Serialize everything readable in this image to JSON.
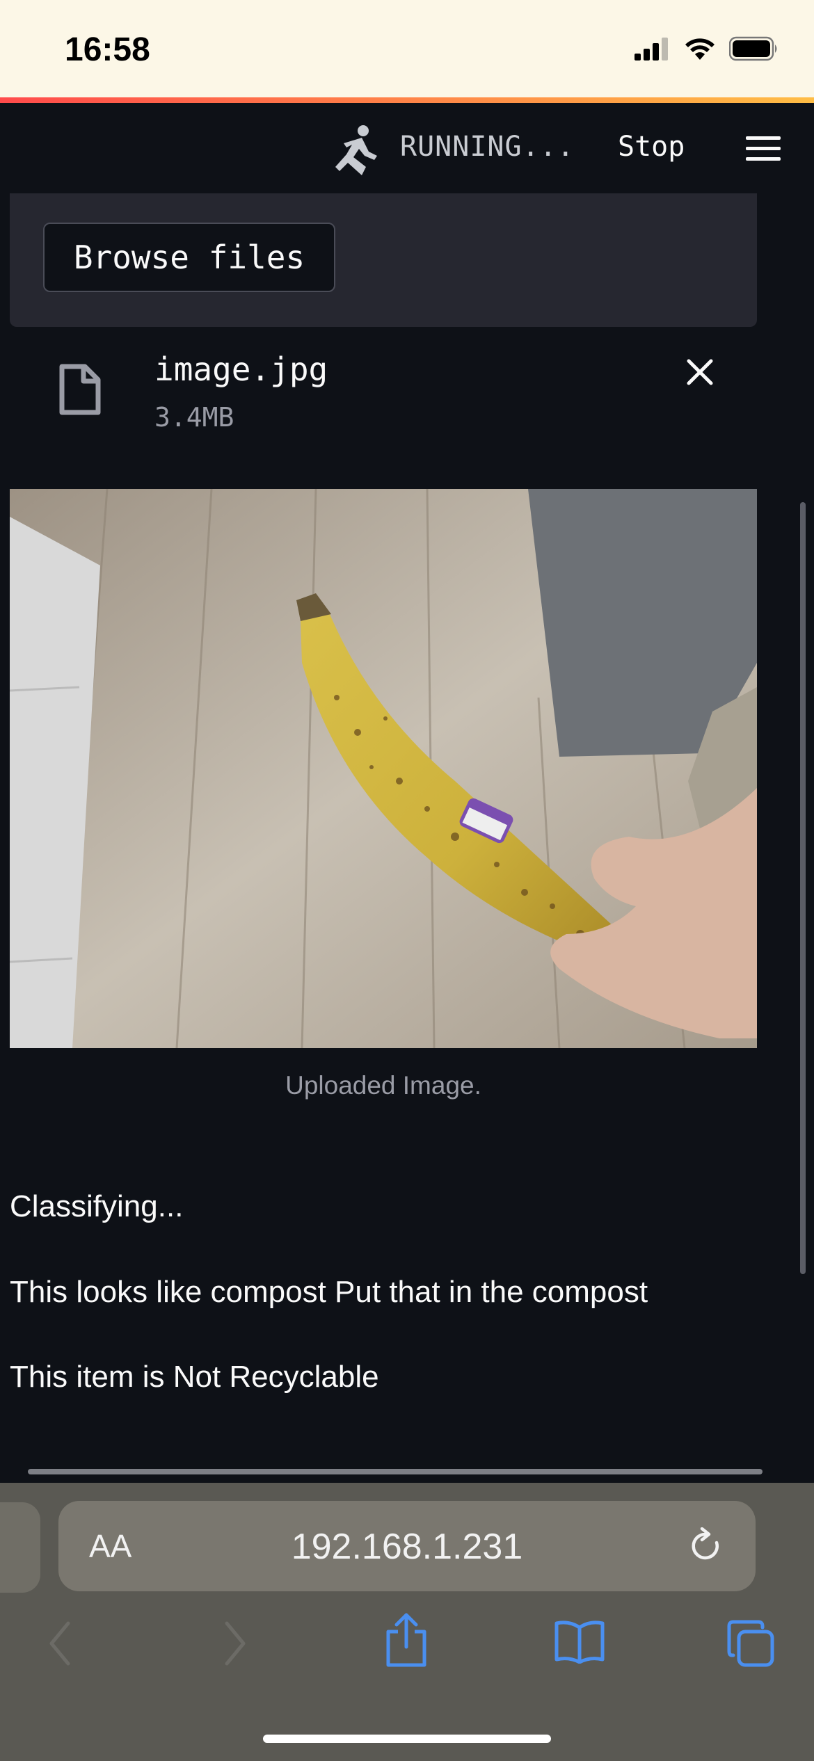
{
  "status_bar": {
    "time": "16:58"
  },
  "header": {
    "running_label": "RUNNING...",
    "stop_label": "Stop"
  },
  "uploader": {
    "browse_label": "Browse files",
    "file": {
      "name": "image.jpg",
      "size": "3.4MB"
    }
  },
  "image": {
    "caption": "Uploaded Image."
  },
  "results": {
    "line1": "Classifying...",
    "line2": "This looks like compost Put that in the compost",
    "line3": "This item is Not Recyclable"
  },
  "safari": {
    "aa_label": "AA",
    "url": "192.168.1.231"
  },
  "colors": {
    "app_bg": "#0e1117",
    "uploader_bg": "#262730",
    "status_bar_bg": "#fcf7e7",
    "safari_bg": "#5a5953",
    "toolbar_icon": "#4a8ff0"
  }
}
